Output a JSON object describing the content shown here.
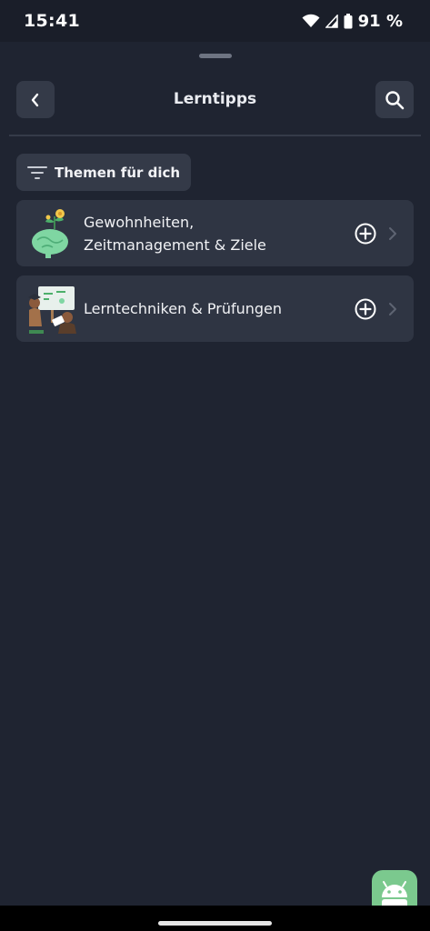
{
  "status_bar": {
    "time": "15:41",
    "battery": "91 %",
    "icons": [
      "wifi-icon",
      "signal-icon",
      "battery-icon"
    ]
  },
  "header": {
    "title": "Lerntipps",
    "back_icon": "chevron-left-icon",
    "search_icon": "search-icon"
  },
  "filter": {
    "label": "Themen für dich",
    "icon": "filter-icon"
  },
  "topics": [
    {
      "title_line1": "Gewohnheiten,",
      "title_line2": "Zeitmanagement & Ziele",
      "illustration": "brain-plant-illustration"
    },
    {
      "title_line1": "Lerntechniken & Prüfungen",
      "illustration": "students-board-illustration"
    }
  ],
  "colors": {
    "background": "#1f2431",
    "card": "#2f3543",
    "button": "#343a48",
    "accent_green": "#7bc98e"
  }
}
